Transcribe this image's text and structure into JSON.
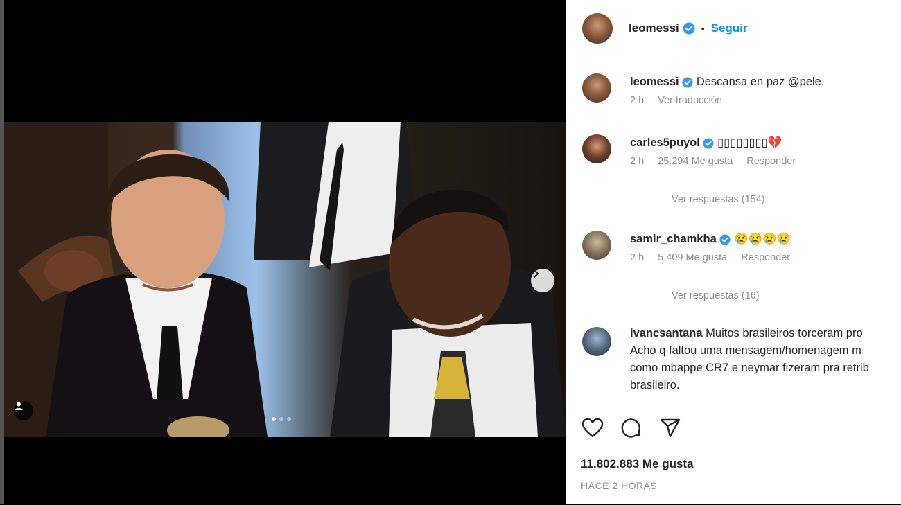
{
  "post": {
    "carousel": {
      "slide_count": 3,
      "active_slide": 1
    }
  },
  "header": {
    "username": "leomessi",
    "separator": "•",
    "follow_label": "Seguir",
    "verified": true
  },
  "comments": [
    {
      "username": "leomessi",
      "text": "Descansa en paz @pele.",
      "time": "2 h",
      "action": "Ver traducción"
    },
    {
      "username": "carles5puyol",
      "text": "▯▯▯▯▯▯▯▯💔",
      "time": "2 h",
      "likes": "25.294 Me gusta",
      "action": "Responder",
      "replies": "Ver respuestas (154)"
    },
    {
      "username": "samir_chamkha",
      "text": "😢😢😢😢",
      "time": "2 h",
      "likes": "5.409 Me gusta",
      "action": "Responder",
      "replies": "Ver respuestas (16)"
    },
    {
      "username": "ivancsantana",
      "lines": [
        "Muitos brasileiros torceram pro",
        "Acho q faltou uma mensagem/homenagem m",
        "como mbappe CR7 e neymar fizeram pra retrib",
        "brasileiro."
      ]
    }
  ],
  "footer": {
    "likes": "11.802.883 Me gusta",
    "timestamp": "HACE 2 HORAS"
  },
  "icons": {
    "like": "heart-icon",
    "comment": "comment-icon",
    "share": "share-icon",
    "next": "chevron-right-icon",
    "tag": "user-tag-icon",
    "verified": "verified-badge-icon"
  },
  "colors": {
    "accent": "#0095f6",
    "verified": "#3897f0",
    "muted": "#8e8e8e"
  }
}
